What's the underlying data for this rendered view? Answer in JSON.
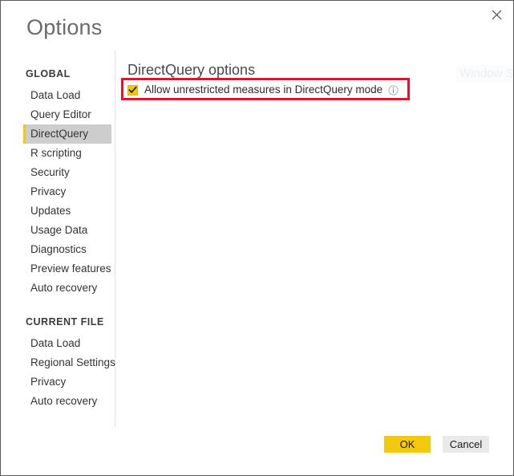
{
  "dialog": {
    "title": "Options",
    "close_icon": "close-icon"
  },
  "watermark": {
    "text": "Window S"
  },
  "sidebar": {
    "groups": [
      {
        "header": "GLOBAL",
        "items": [
          {
            "label": "Data Load",
            "selected": false
          },
          {
            "label": "Query Editor",
            "selected": false
          },
          {
            "label": "DirectQuery",
            "selected": true
          },
          {
            "label": "R scripting",
            "selected": false
          },
          {
            "label": "Security",
            "selected": false
          },
          {
            "label": "Privacy",
            "selected": false
          },
          {
            "label": "Updates",
            "selected": false
          },
          {
            "label": "Usage Data",
            "selected": false
          },
          {
            "label": "Diagnostics",
            "selected": false
          },
          {
            "label": "Preview features",
            "selected": false
          },
          {
            "label": "Auto recovery",
            "selected": false
          }
        ]
      },
      {
        "header": "CURRENT FILE",
        "items": [
          {
            "label": "Data Load",
            "selected": false
          },
          {
            "label": "Regional Settings",
            "selected": false
          },
          {
            "label": "Privacy",
            "selected": false
          },
          {
            "label": "Auto recovery",
            "selected": false
          }
        ]
      }
    ]
  },
  "main": {
    "section_title": "DirectQuery options",
    "checkbox": {
      "label": "Allow unrestricted measures in DirectQuery mode",
      "checked": true,
      "info_icon": "info-icon"
    }
  },
  "footer": {
    "ok_label": "OK",
    "cancel_label": "Cancel"
  },
  "colors": {
    "accent_yellow": "#f2c811",
    "callout_red": "#e8112d",
    "selected_nav_bg": "#cdcdcd",
    "cancel_bg": "#e9e9e9"
  }
}
